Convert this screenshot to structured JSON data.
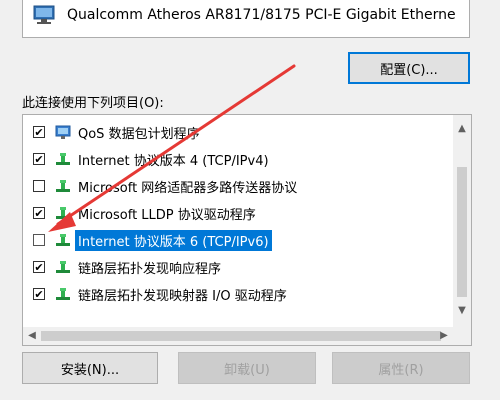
{
  "adapter": {
    "name": "Qualcomm Atheros AR8171/8175 PCI-E Gigabit Etherne"
  },
  "configure_button": "配置(C)...",
  "items_label": "此连接使用下列项目(O):",
  "items": [
    {
      "label": "QoS 数据包计划程序",
      "checked": true,
      "icon": "qos-scheduler-icon"
    },
    {
      "label": "Internet 协议版本 4 (TCP/IPv4)",
      "checked": true,
      "icon": "network-protocol-icon"
    },
    {
      "label": "Microsoft 网络适配器多路传送器协议",
      "checked": false,
      "icon": "network-protocol-icon"
    },
    {
      "label": "Microsoft LLDP 协议驱动程序",
      "checked": true,
      "icon": "network-protocol-icon"
    },
    {
      "label": "Internet 协议版本 6 (TCP/IPv6)",
      "checked": false,
      "icon": "network-protocol-icon",
      "selected": true
    },
    {
      "label": "链路层拓扑发现响应程序",
      "checked": true,
      "icon": "network-protocol-icon"
    },
    {
      "label": "链路层拓扑发现映射器 I/O 驱动程序",
      "checked": true,
      "icon": "network-protocol-icon"
    }
  ],
  "buttons": {
    "install": "安装(N)...",
    "uninstall": "卸载(U)",
    "properties": "属性(R)"
  },
  "colors": {
    "selection": "#0078d7",
    "annotation_arrow": "#e53935"
  }
}
